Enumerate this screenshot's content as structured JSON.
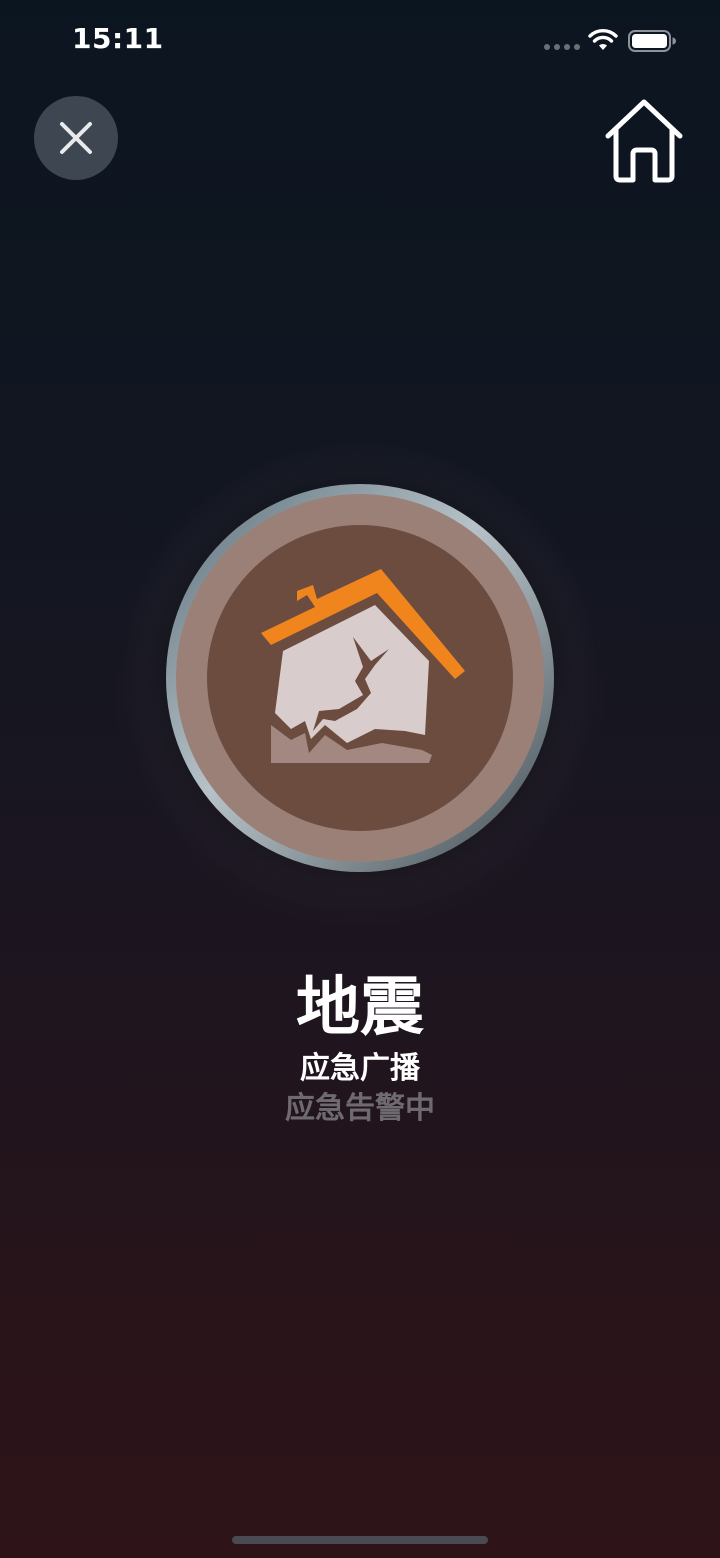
{
  "status_bar": {
    "time": "15:11"
  },
  "alert": {
    "title": "地震",
    "subtitle": "应急广播",
    "status": "应急告警中"
  },
  "colors": {
    "roof_orange": "#f0851e",
    "badge_brown": "#6d4c40",
    "badge_ring": "#9b8078",
    "status_gray": "#6e6a70"
  },
  "icons": {
    "close": "close-icon",
    "home": "home-icon",
    "earthquake": "earthquake-house-icon"
  }
}
